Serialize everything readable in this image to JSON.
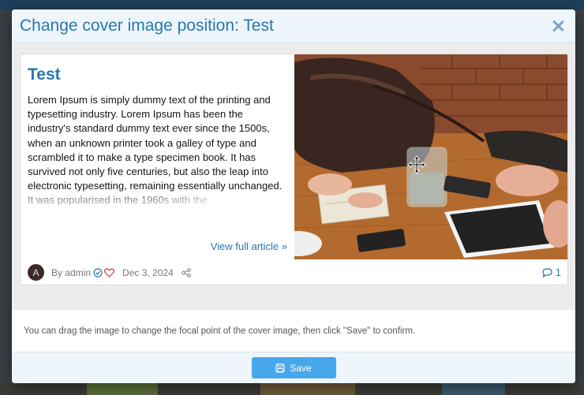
{
  "modal": {
    "title": "Change cover image position: Test",
    "close_icon": "close-icon"
  },
  "article": {
    "title": "Test",
    "body": "Lorem Ipsum is simply dummy text of the printing and typesetting industry. Lorem Ipsum has been the industry's standard dummy text ever since the 1500s, when an unknown printer took a galley of type and scrambled it to make a type specimen book. It has survived not only five centuries, but also the leap into electronic typesetting, remaining essentially unchanged. It was popularised in the 1960s with the",
    "view_full": "View full article »",
    "cover_image": "photo-two-people-with-tablet-phone-notebook-glass-of-water-on-wooden-table"
  },
  "footer_meta": {
    "avatar_letter": "A",
    "author": "By admin",
    "date": "Dec 3, 2024",
    "comments_count": "1",
    "icons": [
      "verified-icon",
      "heart-icon",
      "share-icon",
      "comment-icon"
    ]
  },
  "info": {
    "text": "You can drag the image to change the focal point of the cover image, then click \"Save\" to confirm."
  },
  "actions": {
    "save_label": "Save",
    "save_icon": "save-icon"
  },
  "colors": {
    "accent": "#2577b1",
    "button": "#47a7eb",
    "header_bg": "#eef5fb",
    "heart": "#d9343a"
  }
}
